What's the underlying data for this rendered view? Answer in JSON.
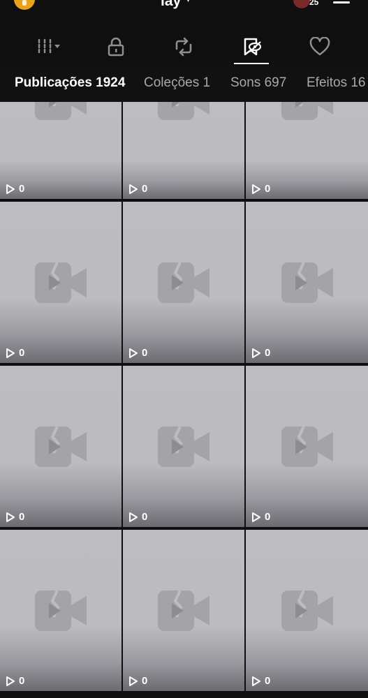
{
  "header": {
    "username": "lay",
    "notification_count": "25"
  },
  "icon_tabs": [
    {
      "name": "tab-filter",
      "icon": "filter-columns-icon"
    },
    {
      "name": "tab-private",
      "icon": "lock-icon"
    },
    {
      "name": "tab-reposts",
      "icon": "repost-icon"
    },
    {
      "name": "tab-favorites",
      "icon": "bookmark-icon",
      "active": true
    },
    {
      "name": "tab-liked",
      "icon": "heart-icon"
    }
  ],
  "text_tabs": [
    {
      "label": "Publicações 1924",
      "active": true
    },
    {
      "label": "Coleções 1",
      "active": false
    },
    {
      "label": "Sons 697",
      "active": false
    },
    {
      "label": "Efeitos 16",
      "active": false
    }
  ],
  "videos": [
    {
      "views": "0"
    },
    {
      "views": "0"
    },
    {
      "views": "0"
    },
    {
      "views": "0"
    },
    {
      "views": "0"
    },
    {
      "views": "0"
    },
    {
      "views": "0"
    },
    {
      "views": "0"
    },
    {
      "views": "0"
    },
    {
      "views": "0"
    },
    {
      "views": "0"
    },
    {
      "views": "0"
    }
  ],
  "colors": {
    "background": "#0f0f0f",
    "tile": "#bdbdc1",
    "placeholder_icon": "#a4a4a8"
  }
}
